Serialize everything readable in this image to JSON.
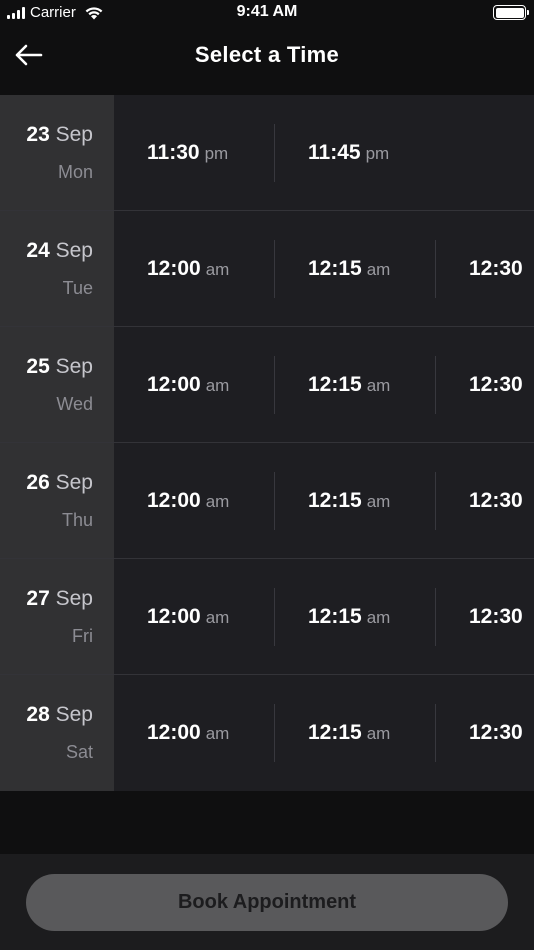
{
  "status_bar": {
    "carrier": "Carrier",
    "time": "9:41 AM"
  },
  "nav": {
    "title": "Select a Time",
    "back_icon": "arrow-left-icon"
  },
  "days": [
    {
      "day": "23",
      "month": "Sep",
      "weekday": "Mon",
      "slots": [
        {
          "time": "11:30",
          "period": "pm"
        },
        {
          "time": "11:45",
          "period": "pm"
        }
      ]
    },
    {
      "day": "24",
      "month": "Sep",
      "weekday": "Tue",
      "slots": [
        {
          "time": "12:00",
          "period": "am"
        },
        {
          "time": "12:15",
          "period": "am"
        },
        {
          "time": "12:30",
          "period": ""
        }
      ]
    },
    {
      "day": "25",
      "month": "Sep",
      "weekday": "Wed",
      "slots": [
        {
          "time": "12:00",
          "period": "am"
        },
        {
          "time": "12:15",
          "period": "am"
        },
        {
          "time": "12:30",
          "period": ""
        }
      ]
    },
    {
      "day": "26",
      "month": "Sep",
      "weekday": "Thu",
      "slots": [
        {
          "time": "12:00",
          "period": "am"
        },
        {
          "time": "12:15",
          "period": "am"
        },
        {
          "time": "12:30",
          "period": ""
        }
      ]
    },
    {
      "day": "27",
      "month": "Sep",
      "weekday": "Fri",
      "slots": [
        {
          "time": "12:00",
          "period": "am"
        },
        {
          "time": "12:15",
          "period": "am"
        },
        {
          "time": "12:30",
          "period": ""
        }
      ]
    },
    {
      "day": "28",
      "month": "Sep",
      "weekday": "Sat",
      "slots": [
        {
          "time": "12:00",
          "period": "am"
        },
        {
          "time": "12:15",
          "period": "am"
        },
        {
          "time": "12:30",
          "period": ""
        }
      ]
    }
  ],
  "footer": {
    "book_label": "Book Appointment"
  },
  "colors": {
    "background": "#0f0f10",
    "date_column": "#313133",
    "slot_area": "#1e1e22",
    "button_disabled": "#59595b"
  }
}
